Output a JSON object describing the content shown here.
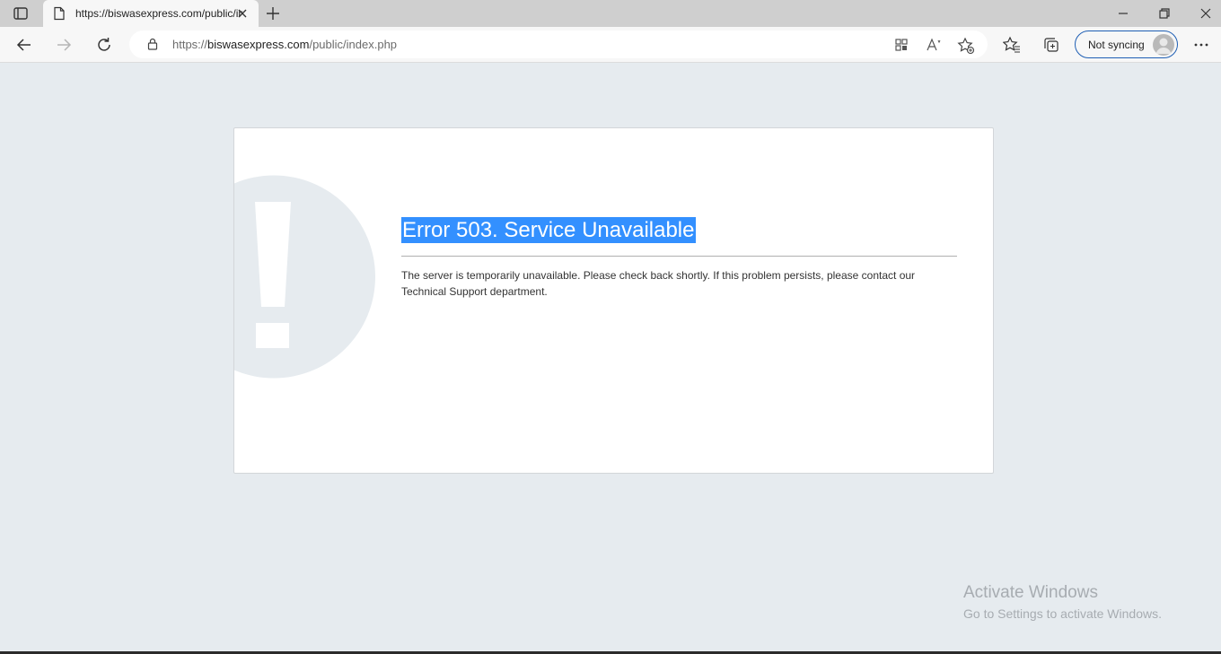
{
  "browser": {
    "tab": {
      "title": "https://biswasexpress.com/public/index.php"
    },
    "address": {
      "scheme": "https://",
      "host": "biswasexpress.com",
      "path": "/public/index.php"
    },
    "profile": {
      "label": "Not syncing"
    },
    "icons": [
      "tab-actions-icon",
      "page-icon",
      "close-icon",
      "plus-icon",
      "minimize-icon",
      "restore-icon",
      "window-close-icon",
      "back-arrow-icon",
      "forward-arrow-icon",
      "refresh-icon",
      "lock-icon",
      "app-available-icon",
      "read-aloud-icon",
      "add-favorite-icon",
      "favorites-icon",
      "collections-icon",
      "more-icon"
    ]
  },
  "page": {
    "error_title": "Error 503. Service Unavailable",
    "error_message": "The server is temporarily unavailable. Please check back shortly. If this problem persists, please contact our Technical Support department.",
    "colors": {
      "background": "#e6ebef",
      "selection": "#3390ff",
      "mark": "#e6ebef"
    }
  },
  "watermark": {
    "line1": "Activate Windows",
    "line2": "Go to Settings to activate Windows."
  }
}
